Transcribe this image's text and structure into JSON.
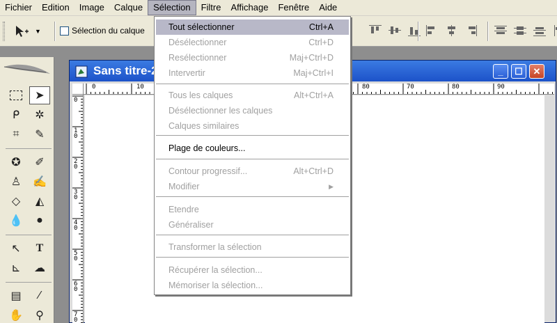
{
  "menubar": [
    "Fichier",
    "Edition",
    "Image",
    "Calque",
    "Sélection",
    "Filtre",
    "Affichage",
    "Fenêtre",
    "Aide"
  ],
  "options": {
    "tool_icon": "move-tool-icon",
    "checkbox_label": "Sélection du calque"
  },
  "document": {
    "title": "Sans titre-2"
  },
  "ruler": {
    "top_labels": [
      "0",
      "10",
      "80",
      "70",
      "80",
      "90"
    ],
    "left_labels": [
      "0",
      "1\n0",
      "2\n0",
      "3\n0",
      "4\n0",
      "5\n0",
      "6\n0",
      "7\n0"
    ]
  },
  "dropdown": {
    "items": [
      {
        "label": "Tout sélectionner",
        "shortcut": "Ctrl+A",
        "enabled": true,
        "highlighted": true
      },
      {
        "label": "Désélectionner",
        "shortcut": "Ctrl+D",
        "enabled": false
      },
      {
        "label": "Resélectionner",
        "shortcut": "Maj+Ctrl+D",
        "enabled": false
      },
      {
        "label": "Intervertir",
        "shortcut": "Maj+Ctrl+I",
        "enabled": false
      },
      {
        "label": "Tous les calques",
        "shortcut": "Alt+Ctrl+A",
        "enabled": false
      },
      {
        "label": "Désélectionner les calques",
        "shortcut": "",
        "enabled": false
      },
      {
        "label": "Calques similaires",
        "shortcut": "",
        "enabled": false
      },
      {
        "label": "Plage de couleurs...",
        "shortcut": "",
        "enabled": true
      },
      {
        "label": "Contour progressif...",
        "shortcut": "Alt+Ctrl+D",
        "enabled": false
      },
      {
        "label": "Modifier",
        "shortcut": "",
        "enabled": false,
        "submenu": true
      },
      {
        "label": "Etendre",
        "shortcut": "",
        "enabled": false
      },
      {
        "label": "Généraliser",
        "shortcut": "",
        "enabled": false
      },
      {
        "label": "Transformer la sélection",
        "shortcut": "",
        "enabled": false
      },
      {
        "label": "Récupérer la sélection...",
        "shortcut": "",
        "enabled": false
      },
      {
        "label": "Mémoriser la sélection...",
        "shortcut": "",
        "enabled": false
      }
    ]
  },
  "colors": {
    "menu_highlight": "#b8b8c8",
    "title_bar": "#1c52c9",
    "disabled_text": "#a0a0a0"
  }
}
